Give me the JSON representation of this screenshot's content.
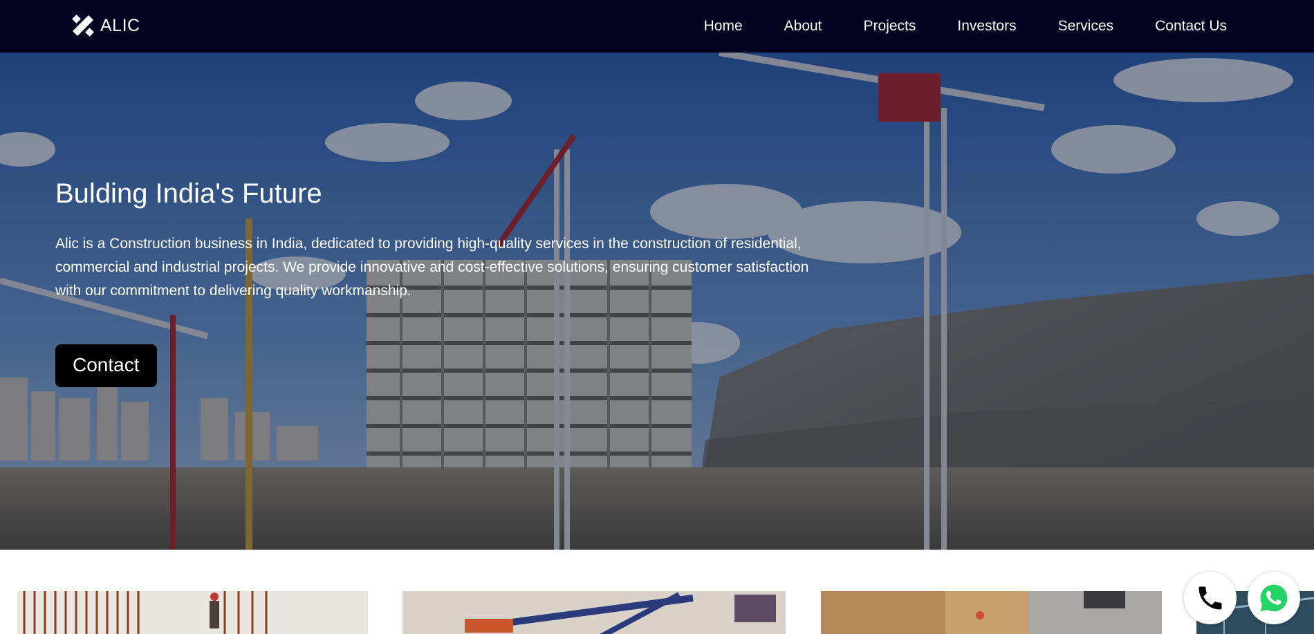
{
  "brand": {
    "name": "ALIC",
    "icon": "percent-logo-icon"
  },
  "nav": {
    "items": [
      {
        "label": "Home"
      },
      {
        "label": "About"
      },
      {
        "label": "Projects"
      },
      {
        "label": "Investors"
      },
      {
        "label": "Services"
      },
      {
        "label": "Contact Us"
      }
    ]
  },
  "hero": {
    "title": "Bulding India's Future",
    "text": "Alic is a Construction business in India, dedicated to providing high-quality services in the construction of residential, commercial and industrial projects. We provide innovative and cost-effective solutions, ensuring customer satisfaction with our commitment to delivering quality workmanship.",
    "button_label": "Contact",
    "background": "construction-site-photo"
  },
  "floating": {
    "phone_icon": "phone-icon",
    "whatsapp_icon": "whatsapp-icon"
  },
  "colors": {
    "navbar": "#030320",
    "button": "#000000",
    "whatsapp": "#25d366"
  }
}
